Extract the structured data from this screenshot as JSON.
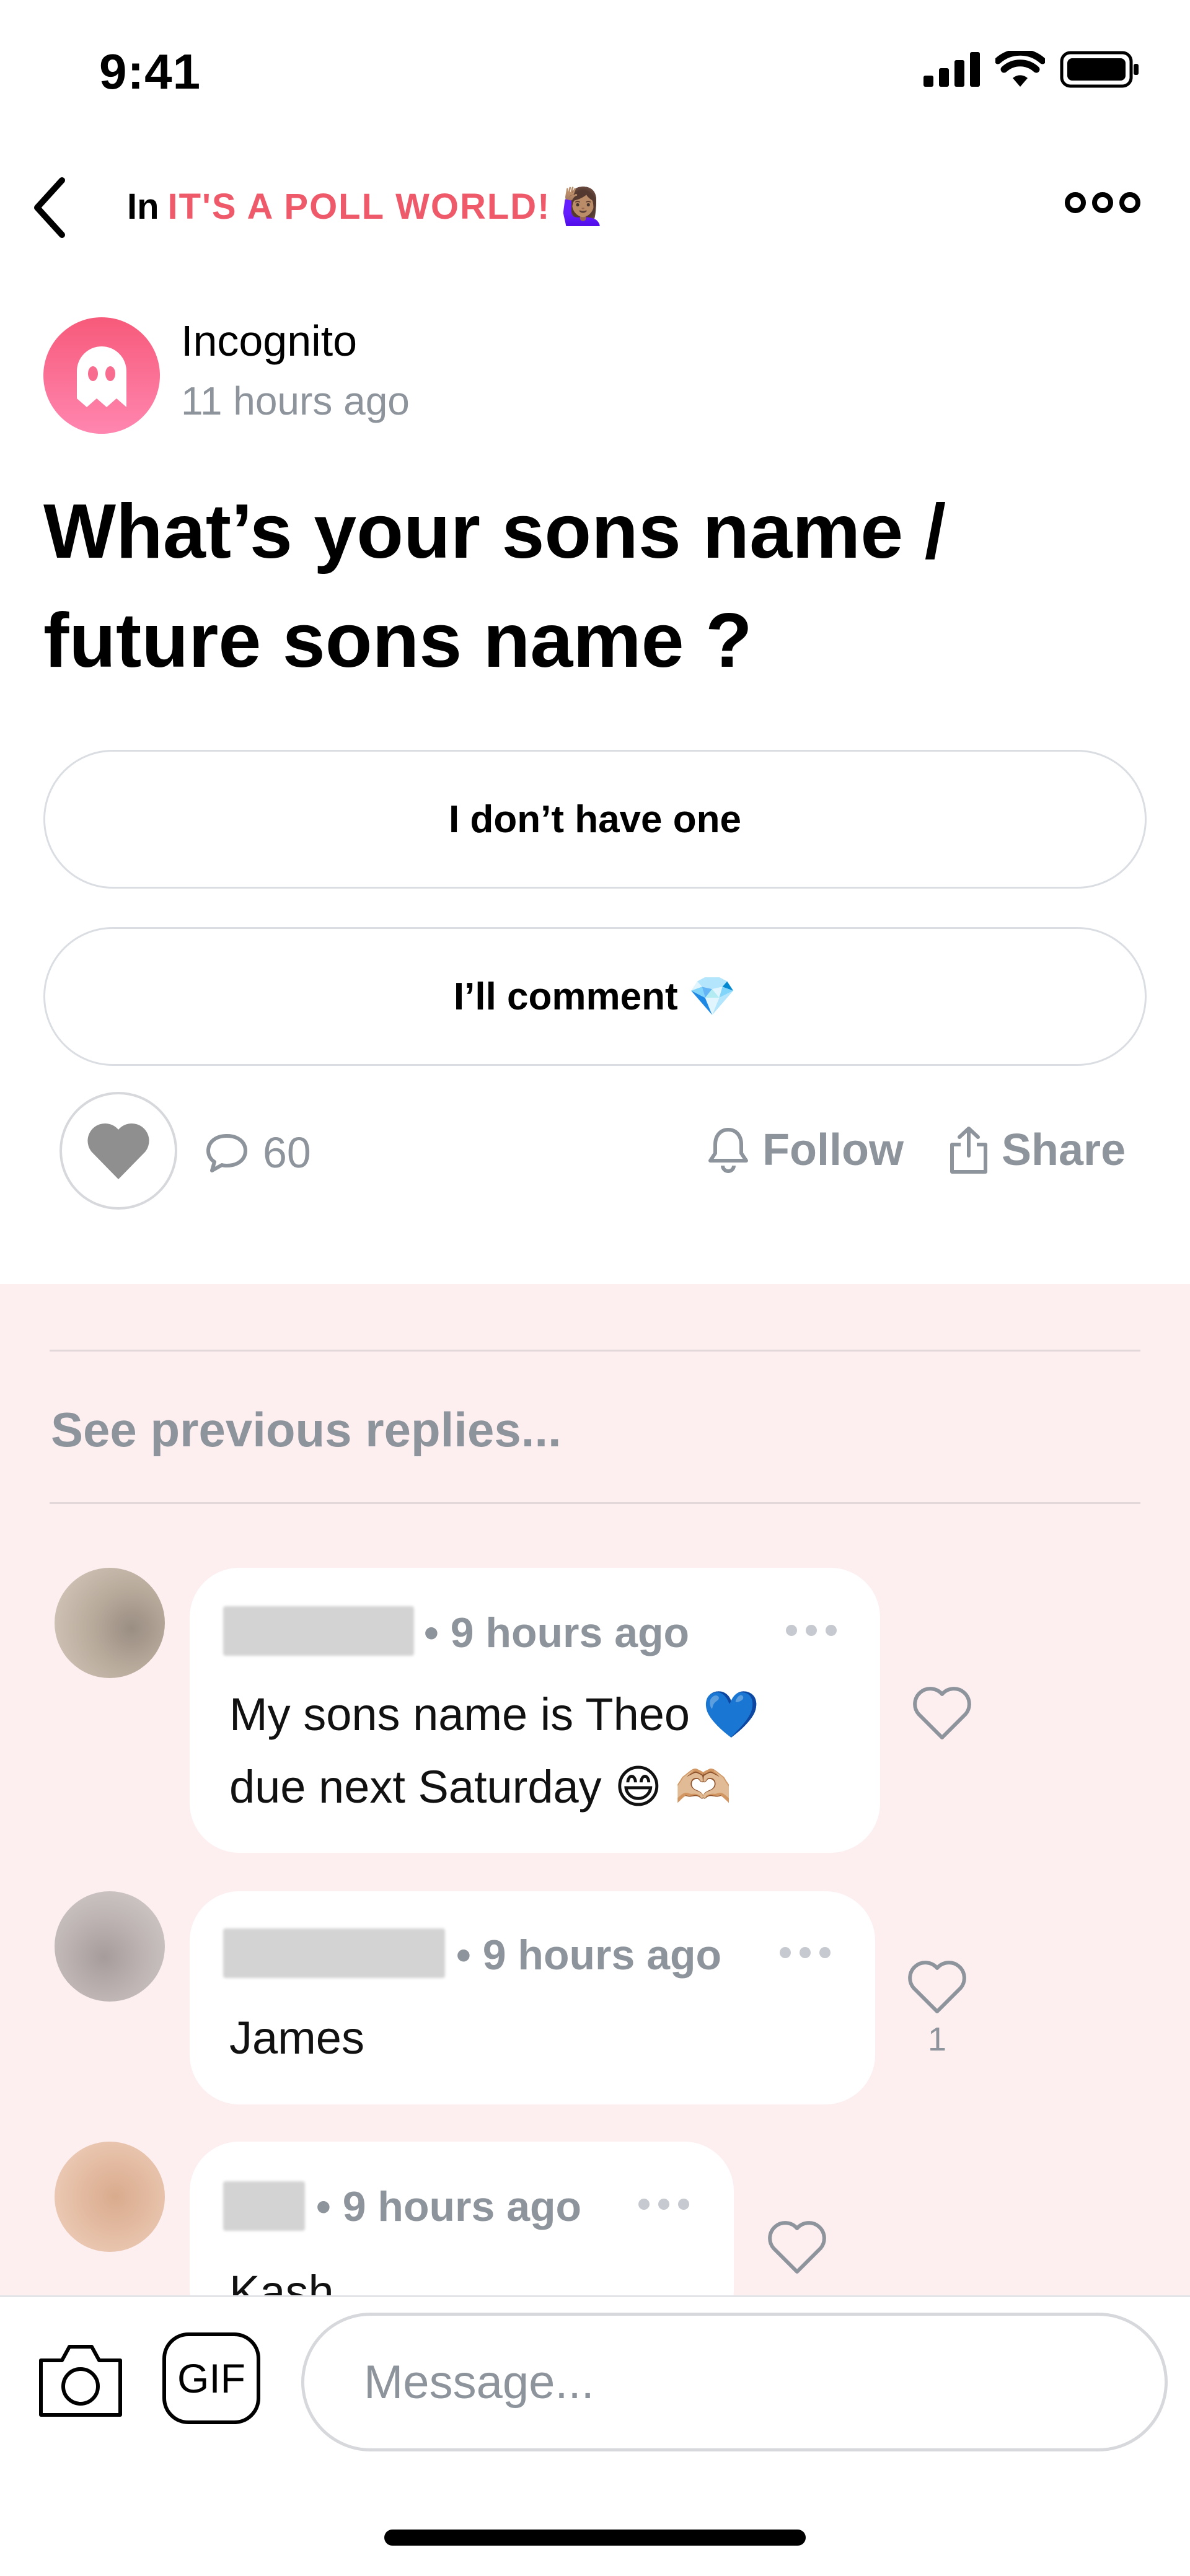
{
  "status_bar": {
    "time": "9:41"
  },
  "nav": {
    "prefix": "In",
    "group_name": "IT'S A POLL WORLD!",
    "group_emoji": "🙋🏽‍♀️"
  },
  "post": {
    "author": "Incognito",
    "time": "11 hours ago",
    "title": "What’s your sons name / future sons name ?",
    "options": [
      {
        "label": "I don’t have one"
      },
      {
        "label": "I’ll comment 💎"
      }
    ],
    "comment_count": "60",
    "follow_label": "Follow",
    "share_label": "Share"
  },
  "replies": {
    "see_previous": "See previous replies...",
    "items": [
      {
        "meta": "• 9 hours ago",
        "text_line1": "My sons name is Theo 💙",
        "text_line2": "due next Saturday 😄 🫶🏼",
        "likes": ""
      },
      {
        "meta": "• 9 hours ago",
        "text_line1": "James",
        "likes": "1"
      },
      {
        "meta": "• 9 hours ago",
        "text_line1": "Kash",
        "likes": ""
      }
    ]
  },
  "composer": {
    "placeholder": "Message...",
    "gif_label": "GIF"
  },
  "colors": {
    "accent": "#ef5a6a",
    "muted": "#8e949c",
    "replies_bg": "#fdeef0"
  }
}
